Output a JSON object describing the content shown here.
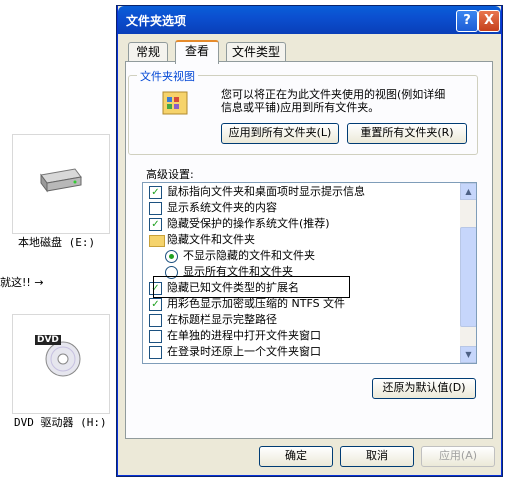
{
  "desktop": {
    "drive_c": {
      "label": "本地磁盘 (E:)",
      "icon": "hard-drive-icon"
    },
    "drive_d": {
      "label": "DVD 驱动器 (H:)",
      "icon": "dvd-drive-icon",
      "badge": "DVD"
    },
    "annotation": "就这!! →"
  },
  "dialog": {
    "title": "文件夹选项",
    "help": "?",
    "close": "X",
    "tabs": [
      {
        "label": "常规"
      },
      {
        "label": "查看"
      },
      {
        "label": "文件类型"
      }
    ],
    "folder_view": {
      "title": "文件夹视图",
      "description_line1": "您可以将正在为此文件夹使用的视图(例如详细",
      "description_line2": "信息或平铺)应用到所有文件夹。",
      "apply_all": "应用到所有文件夹(L)",
      "reset_all": "重置所有文件夹(R)"
    },
    "advanced_label": "高级设置:",
    "settings": [
      {
        "type": "checkbox",
        "checked": true,
        "label": "鼠标指向文件夹和桌面项时显示提示信息"
      },
      {
        "type": "checkbox",
        "checked": false,
        "label": "显示系统文件夹的内容"
      },
      {
        "type": "checkbox",
        "checked": true,
        "label": "隐藏受保护的操作系统文件(推荐)"
      },
      {
        "type": "folder",
        "label": "隐藏文件和文件夹"
      },
      {
        "type": "radio",
        "checked": true,
        "label": "不显示隐藏的文件和文件夹"
      },
      {
        "type": "radio",
        "checked": false,
        "label": "显示所有文件和文件夹"
      },
      {
        "type": "checkbox",
        "checked": true,
        "label": "隐藏已知文件类型的扩展名"
      },
      {
        "type": "checkbox",
        "checked": true,
        "label": "用彩色显示加密或压缩的 NTFS 文件"
      },
      {
        "type": "checkbox",
        "checked": false,
        "label": "在标题栏显示完整路径"
      },
      {
        "type": "checkbox",
        "checked": false,
        "label": "在单独的进程中打开文件夹窗口"
      },
      {
        "type": "checkbox",
        "checked": false,
        "label": "在登录时还原上一个文件夹窗口"
      }
    ],
    "restore_defaults": "还原为默认值(D)",
    "ok": "确定",
    "cancel": "取消",
    "apply": "应用(A)"
  }
}
